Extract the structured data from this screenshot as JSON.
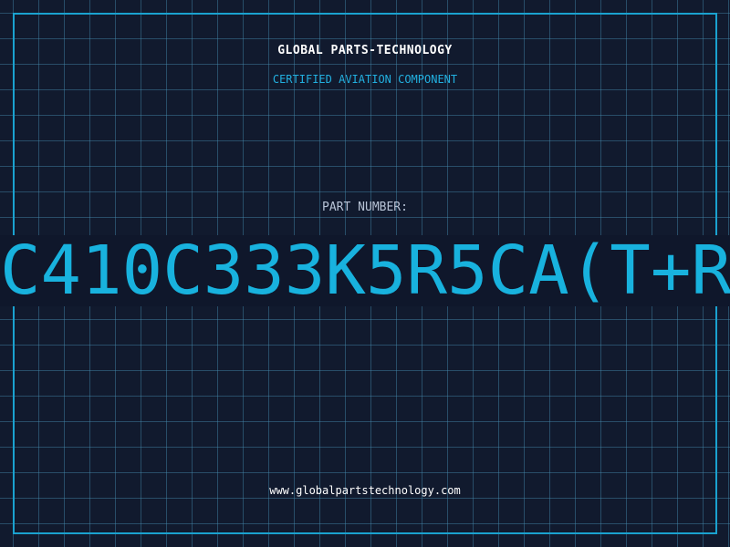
{
  "header": {
    "brand": "GLOBAL PARTS-TECHNOLOGY",
    "subtitle": "CERTIFIED AVIATION COMPONENT"
  },
  "part": {
    "label": "PART NUMBER:",
    "number": "C410C333K5R5CA(T+R"
  },
  "footer": {
    "website": "www.globalpartstechnology.com"
  },
  "colors": {
    "background": "#111a2e",
    "grid": "#468caf",
    "accent": "#18b2de",
    "text": "#ffffff"
  }
}
